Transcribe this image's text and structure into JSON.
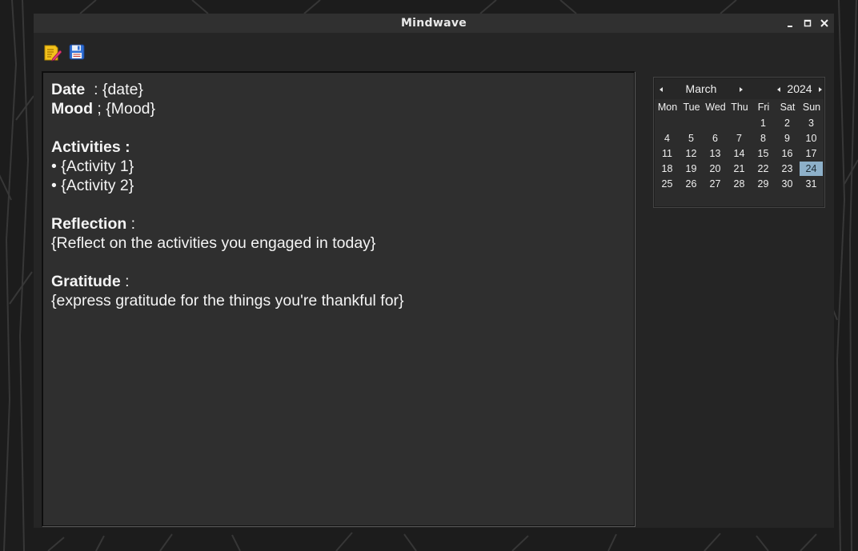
{
  "window": {
    "title": "Mindwave"
  },
  "toolbar": {
    "buttons": [
      {
        "icon": "edit-note-icon"
      },
      {
        "icon": "save-icon"
      }
    ]
  },
  "editor": {
    "date_label": "Date",
    "date_value": "  : {date}",
    "mood_label": "Mood",
    "mood_value": " ; {Mood}",
    "activities_label": "Activities :",
    "activity_1": "• {Activity 1}",
    "activity_2": "• {Activity 2}",
    "reflection_label": "Reflection",
    "reflection_sep": " :",
    "reflection_text": "{Reflect on the activities you engaged in today}",
    "gratitude_label": "Gratitude",
    "gratitude_sep": " :",
    "gratitude_text": "{express gratitude for the things you're thankful for}"
  },
  "calendar": {
    "month": "March",
    "year": "2024",
    "weekdays": [
      "Mon",
      "Tue",
      "Wed",
      "Thu",
      "Fri",
      "Sat",
      "Sun"
    ],
    "weeks": [
      [
        "",
        "",
        "",
        "",
        "1",
        "2",
        "3"
      ],
      [
        "4",
        "5",
        "6",
        "7",
        "8",
        "9",
        "10"
      ],
      [
        "11",
        "12",
        "13",
        "14",
        "15",
        "16",
        "17"
      ],
      [
        "18",
        "19",
        "20",
        "21",
        "22",
        "23",
        "24"
      ],
      [
        "25",
        "26",
        "27",
        "28",
        "29",
        "30",
        "31"
      ]
    ],
    "selected_day": "24",
    "selected_color": "#8db0c9"
  }
}
